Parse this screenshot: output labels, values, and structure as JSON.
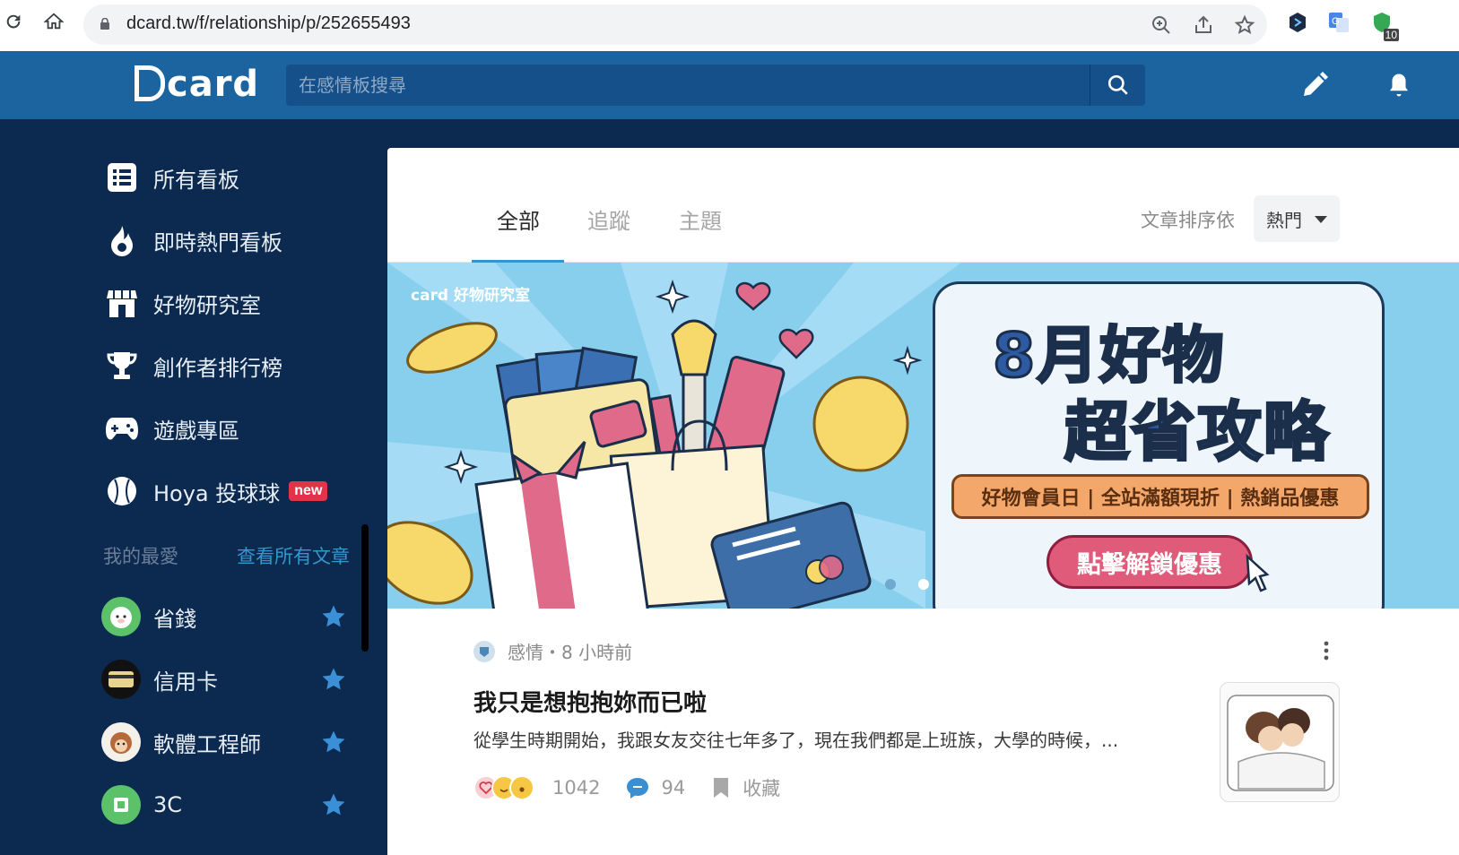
{
  "browser": {
    "url": "dcard.tw/f/relationship/p/252655493",
    "extension_badge": "10"
  },
  "header": {
    "logo_text": "card",
    "search_placeholder": "在感情板搜尋"
  },
  "sidebar": {
    "items": [
      {
        "label": "所有看板",
        "icon": "list-icon"
      },
      {
        "label": "即時熱門看板",
        "icon": "flame-icon"
      },
      {
        "label": "好物研究室",
        "icon": "store-icon"
      },
      {
        "label": "創作者排行榜",
        "icon": "trophy-icon"
      },
      {
        "label": "遊戲專區",
        "icon": "gamepad-icon"
      },
      {
        "label": "Hoya 投球球",
        "icon": "baseball-icon",
        "badge": "new"
      }
    ],
    "favorites_title": "我的最愛",
    "view_all_label": "查看所有文章",
    "favorites": [
      {
        "label": "省錢"
      },
      {
        "label": "信用卡"
      },
      {
        "label": "軟體工程師"
      },
      {
        "label": "3C"
      }
    ]
  },
  "main": {
    "tabs": [
      {
        "label": "全部",
        "active": true
      },
      {
        "label": "追蹤",
        "active": false
      },
      {
        "label": "主題",
        "active": false
      }
    ],
    "sort_label": "文章排序依",
    "sort_value": "熱門",
    "banner": {
      "brand": "card 好物研究室",
      "title_line1": "8月好物",
      "title_line2": "超省攻略",
      "strip_text": "好物會員日 | 全站滿額現折 | 熱銷品優惠",
      "cta": "點擊解鎖優惠"
    },
    "post": {
      "board": "感情",
      "time": "・8 小時前",
      "title": "我只是想抱抱妳而已啦",
      "excerpt": "從學生時期開始，我跟女友交往七年多了，現在我們都是上班族，大學的時候，...",
      "reactions": "1042",
      "comments": "94",
      "save_label": "收藏"
    }
  },
  "colors": {
    "header": "#1b64a0",
    "sidebar": "#0c2a4f",
    "accent": "#3397cf",
    "new_badge": "#e0344b",
    "star": "#3b8fd6"
  }
}
